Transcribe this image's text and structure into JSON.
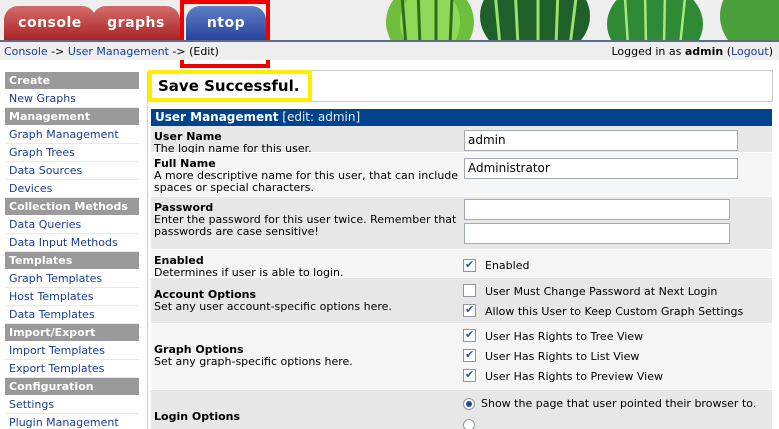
{
  "tabs": [
    {
      "label": "console"
    },
    {
      "label": "graphs"
    },
    {
      "label": "ntop"
    }
  ],
  "breadcrumb": {
    "console": "Console",
    "sep1": " -> ",
    "user_management": "User Management",
    "sep2": " -> ",
    "current": "(Edit)"
  },
  "login": {
    "prefix": "Logged in as ",
    "user": "admin",
    "logout_open": " (",
    "logout": "Logout",
    "logout_close": ")"
  },
  "menu": [
    {
      "type": "header",
      "label": "Create"
    },
    {
      "type": "item",
      "label": "New Graphs"
    },
    {
      "type": "header",
      "label": "Management"
    },
    {
      "type": "item",
      "label": "Graph Management"
    },
    {
      "type": "item",
      "label": "Graph Trees"
    },
    {
      "type": "item",
      "label": "Data Sources"
    },
    {
      "type": "item",
      "label": "Devices"
    },
    {
      "type": "header",
      "label": "Collection Methods"
    },
    {
      "type": "item",
      "label": "Data Queries"
    },
    {
      "type": "item",
      "label": "Data Input Methods"
    },
    {
      "type": "header",
      "label": "Templates"
    },
    {
      "type": "item",
      "label": "Graph Templates"
    },
    {
      "type": "item",
      "label": "Host Templates"
    },
    {
      "type": "item",
      "label": "Data Templates"
    },
    {
      "type": "header",
      "label": "Import/Export"
    },
    {
      "type": "item",
      "label": "Import Templates"
    },
    {
      "type": "item",
      "label": "Export Templates"
    },
    {
      "type": "header",
      "label": "Configuration"
    },
    {
      "type": "item",
      "label": "Settings"
    },
    {
      "type": "item",
      "label": "Plugin Management"
    }
  ],
  "save_message": "Save Successful.",
  "form": {
    "title": "User Management",
    "title_sub": " [edit: admin]",
    "user_name": {
      "title": "User Name",
      "desc": "The login name for this user.",
      "value": "admin"
    },
    "full_name": {
      "title": "Full Name",
      "desc": "A more descriptive name for this user, that can include spaces or special characters.",
      "value": "Administrator"
    },
    "password": {
      "title": "Password",
      "desc": "Enter the password for this user twice. Remember that passwords are case sensitive!",
      "value1": "",
      "value2": ""
    },
    "enabled": {
      "title": "Enabled",
      "desc": "Determines if user is able to login.",
      "checkbox_label": "Enabled",
      "checked": true
    },
    "account_options": {
      "title": "Account Options",
      "desc": "Set any user account-specific options here.",
      "options": [
        {
          "label": "User Must Change Password at Next Login",
          "checked": false
        },
        {
          "label": "Allow this User to Keep Custom Graph Settings",
          "checked": true
        }
      ]
    },
    "graph_options": {
      "title": "Graph Options",
      "desc": "Set any graph-specific options here.",
      "options": [
        {
          "label": "User Has Rights to Tree View",
          "checked": true
        },
        {
          "label": "User Has Rights to List View",
          "checked": true
        },
        {
          "label": "User Has Rights to Preview View",
          "checked": true
        }
      ]
    },
    "login_options": {
      "title": "Login Options",
      "radio1_label": "Show the page that user pointed their browser to.",
      "radio1_selected": true
    }
  }
}
